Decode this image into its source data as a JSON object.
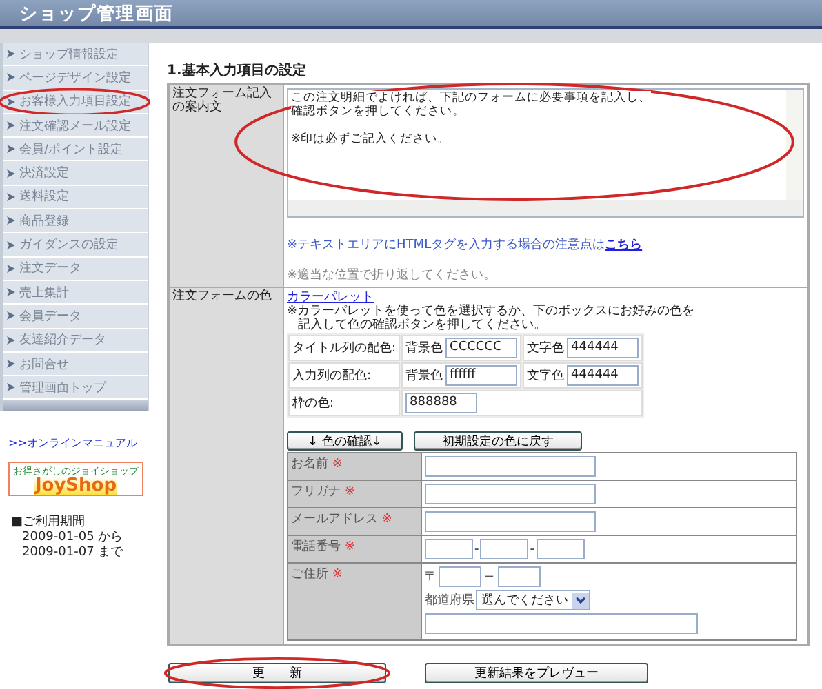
{
  "header": {
    "title": "ショップ管理画面"
  },
  "sidebar": {
    "items": [
      {
        "label": "ショップ情報設定",
        "circled": false
      },
      {
        "label": "ページデザイン設定",
        "circled": false
      },
      {
        "label": "お客様入力項目設定",
        "circled": true
      },
      {
        "label": "注文確認メール設定",
        "circled": false
      },
      {
        "label": "会員/ポイント設定",
        "circled": false
      },
      {
        "label": "決済設定",
        "circled": false
      },
      {
        "label": "送料設定",
        "circled": false
      },
      {
        "label": "商品登録",
        "circled": false
      },
      {
        "label": "ガイダンスの設定",
        "circled": false
      },
      {
        "label": "注文データ",
        "circled": false
      },
      {
        "label": "売上集計",
        "circled": false
      },
      {
        "label": "会員データ",
        "circled": false
      },
      {
        "label": "友達紹介データ",
        "circled": false
      },
      {
        "label": "お問合せ",
        "circled": false
      },
      {
        "label": "管理画面トップ",
        "circled": false
      }
    ],
    "manual_link": ">>オンラインマニュアル",
    "logo": {
      "tagline": "お得さがしのジョイショップ",
      "name": "JoyShop"
    },
    "period": {
      "title": "■ご利用期間",
      "lines": [
        "2009-01-05 から",
        "2009-01-07 まで"
      ]
    }
  },
  "section_title": "1.基本入力項目の設定",
  "guide_row": {
    "label": "注文フォーム記入の案内文",
    "textarea": {
      "lines": [
        "この注文明細でよければ、下記のフォームに必要事項を記入し、",
        "確認ボタンを押してください。",
        "※印は必ずご記入ください。"
      ],
      "circled": true
    },
    "note": "※テキストエリアにHTMLタグを入力する場合の注意点は",
    "note_link": "こちら",
    "hint": "※適当な位置で折り返してください。"
  },
  "color_row": {
    "label": "注文フォームの色",
    "palette_link": "カラーパレット",
    "instruction": [
      "※カラーパレットを使って色を選択するか、下のボックスにお好みの色を",
      "記入して色の確認ボタンを押してください。"
    ],
    "settings": [
      {
        "label": "タイトル列の配色:",
        "fields": [
          {
            "label": "背景色",
            "value": "CCCCCC"
          },
          {
            "label": "文字色",
            "value": "444444"
          }
        ]
      },
      {
        "label": "入力列の配色:",
        "fields": [
          {
            "label": "背景色",
            "value": "ffffff"
          },
          {
            "label": "文字色",
            "value": "444444"
          }
        ]
      },
      {
        "label": "枠の色:",
        "fields": [
          {
            "value": "888888"
          }
        ]
      }
    ],
    "buttons": [
      "↓ 色の確認↓",
      "初期設定の色に戻す"
    ],
    "preview": [
      {
        "kind": "text",
        "label": "お名前",
        "mark": "※"
      },
      {
        "kind": "text",
        "label": "フリガナ",
        "mark": "※"
      },
      {
        "kind": "text",
        "label": "メールアドレス",
        "mark": "※"
      },
      {
        "kind": "tel",
        "label": "電話番号",
        "mark": "※",
        "separator": "-"
      },
      {
        "kind": "address",
        "label": "ご住所",
        "mark": "※",
        "postal_sign": "〒",
        "separator": "−",
        "prefecture_label": "都道府県",
        "prefecture_placeholder": "選んでください"
      }
    ]
  },
  "buttons": [
    {
      "label": "更　　新",
      "circled": true
    },
    {
      "label": "更新結果をプレヴュー",
      "circled": false
    }
  ]
}
